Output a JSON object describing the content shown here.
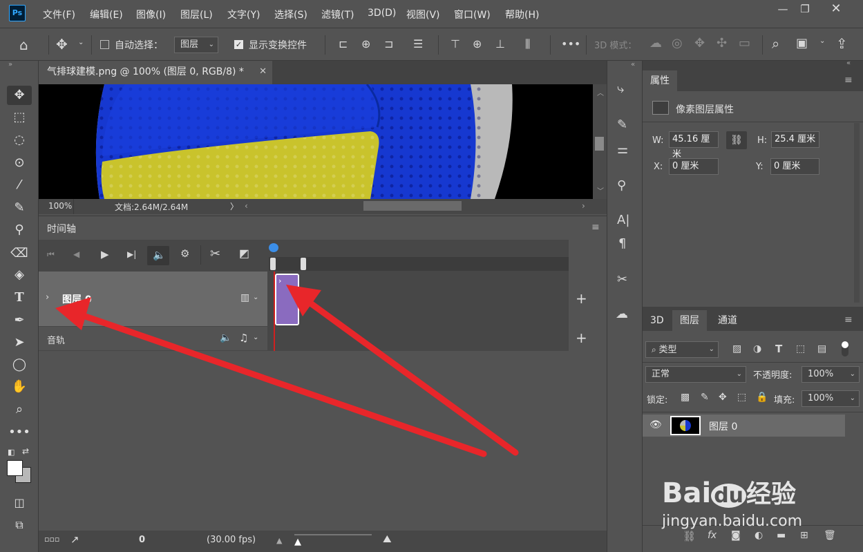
{
  "menubar": {
    "logo": "Ps",
    "items": [
      "文件(F)",
      "编辑(E)",
      "图像(I)",
      "图层(L)",
      "文字(Y)",
      "选择(S)",
      "滤镜(T)",
      "3D(D)",
      "视图(V)",
      "窗口(W)",
      "帮助(H)"
    ]
  },
  "options": {
    "auto_select_label": "自动选择：",
    "auto_select_value": "图层",
    "show_transform_label": "显示变换控件",
    "more": "•••",
    "mode_3d_label": "3D 模式："
  },
  "document": {
    "tab_title": "气排球建模.png @ 100% (图层 0, RGB/8) *",
    "zoom": "100%",
    "doc_info": "文档:2.64M/2.64M"
  },
  "timeline": {
    "title": "时间轴",
    "layer_name": "图层 0",
    "audio_label": "音轨",
    "frame": "0",
    "fps": "(30.00 fps)"
  },
  "properties": {
    "tab": "属性",
    "section": "像素图层属性",
    "w_label": "W:",
    "w_value": "45.16 厘米",
    "h_label": "H:",
    "h_value": "25.4 厘米",
    "x_label": "X:",
    "x_value": "0 厘米",
    "y_label": "Y:",
    "y_value": "0 厘米"
  },
  "layers_panel": {
    "tabs": [
      "3D",
      "图层",
      "通道"
    ],
    "filter_label": "类型",
    "blend_mode": "正常",
    "opacity_label": "不透明度:",
    "opacity_value": "100%",
    "lock_label": "锁定:",
    "fill_label": "填充:",
    "fill_value": "100%",
    "layer_name": "图层 0"
  },
  "watermark": {
    "brand": "Bai",
    "brand2": "du",
    "cn": "经验",
    "url": "jingyan.baidu.com"
  },
  "colors": {
    "panel": "#535353",
    "dark": "#474747",
    "clip": "#8a6bbf",
    "arrow": "#e8262a",
    "accent": "#31a8ff"
  }
}
